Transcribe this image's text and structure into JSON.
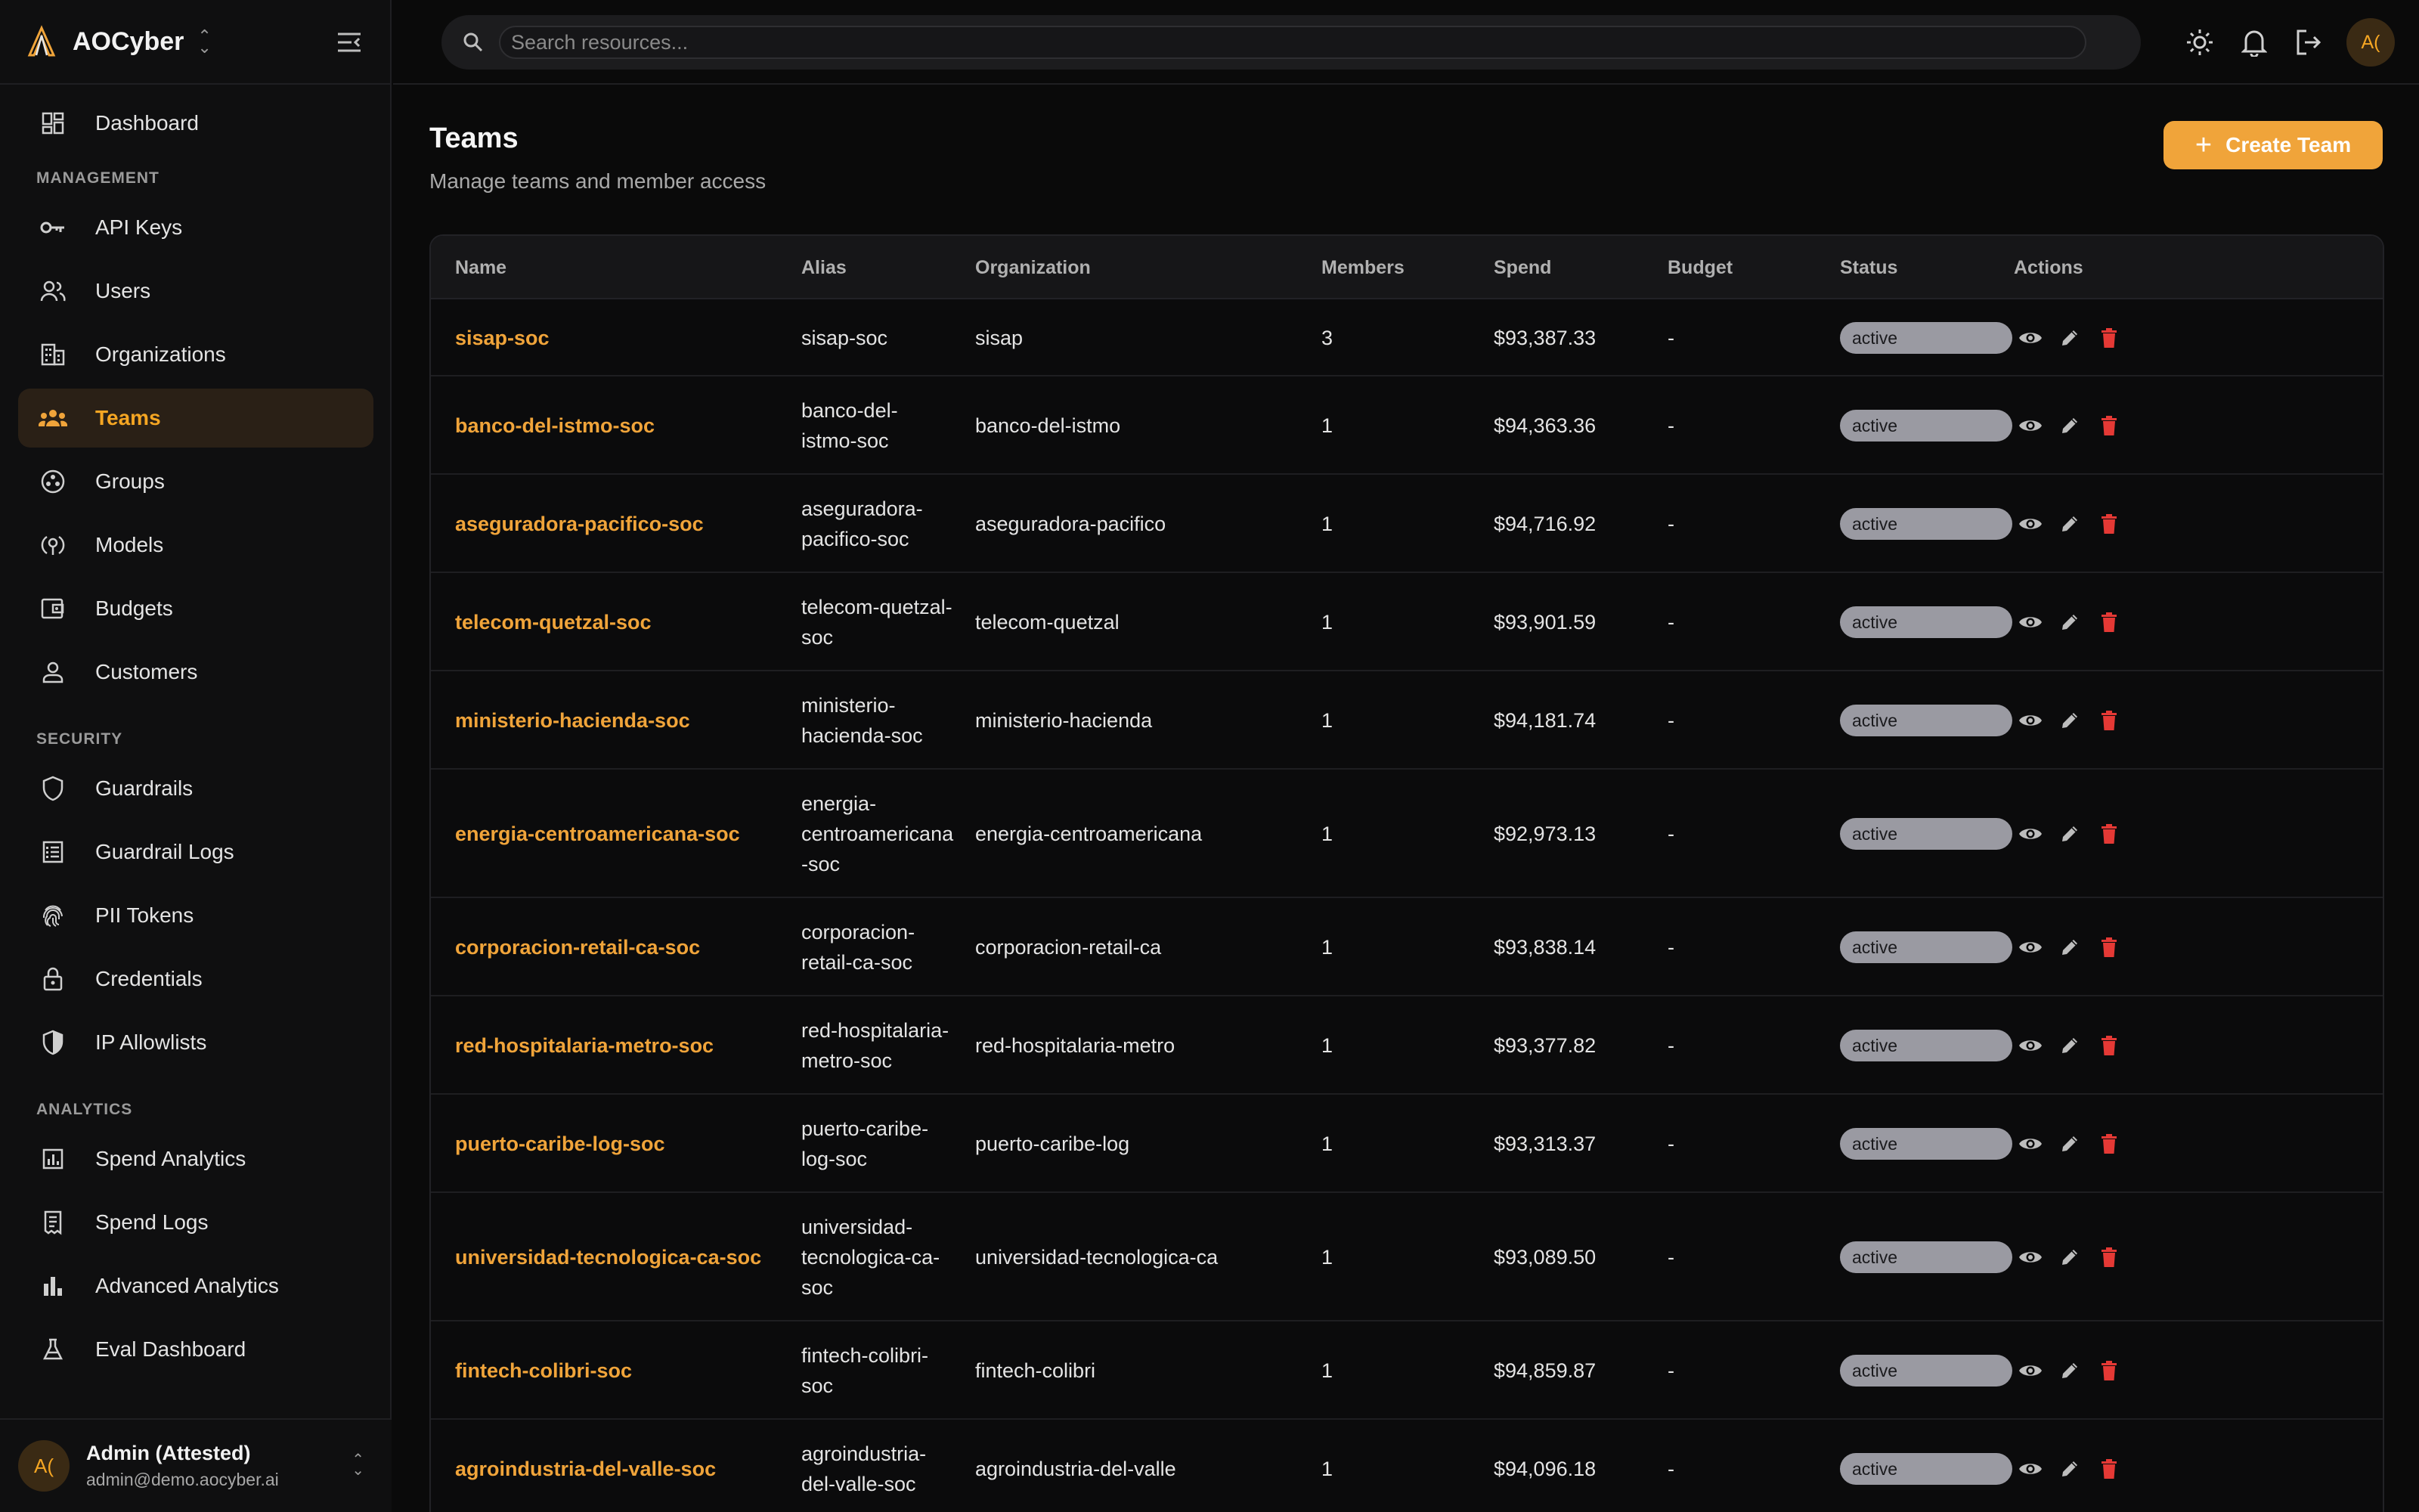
{
  "brand": {
    "name": "AOCyber"
  },
  "nav": {
    "top": [
      {
        "label": "Dashboard",
        "icon": "dashboard-icon"
      }
    ],
    "sections": [
      {
        "title": "MANAGEMENT",
        "items": [
          {
            "label": "API Keys",
            "icon": "key-icon"
          },
          {
            "label": "Users",
            "icon": "users-icon"
          },
          {
            "label": "Organizations",
            "icon": "building-icon"
          },
          {
            "label": "Teams",
            "icon": "team-icon",
            "active": true
          },
          {
            "label": "Groups",
            "icon": "groups-icon"
          },
          {
            "label": "Models",
            "icon": "models-icon"
          },
          {
            "label": "Budgets",
            "icon": "wallet-icon"
          },
          {
            "label": "Customers",
            "icon": "customer-icon"
          }
        ]
      },
      {
        "title": "SECURITY",
        "items": [
          {
            "label": "Guardrails",
            "icon": "shield-icon"
          },
          {
            "label": "Guardrail Logs",
            "icon": "logs-icon"
          },
          {
            "label": "PII Tokens",
            "icon": "fingerprint-icon"
          },
          {
            "label": "Credentials",
            "icon": "lock-icon"
          },
          {
            "label": "IP Allowlists",
            "icon": "shield-half-icon"
          }
        ]
      },
      {
        "title": "ANALYTICS",
        "items": [
          {
            "label": "Spend Analytics",
            "icon": "analytics-icon"
          },
          {
            "label": "Spend Logs",
            "icon": "receipt-icon"
          },
          {
            "label": "Advanced Analytics",
            "icon": "bar-chart-icon"
          },
          {
            "label": "Eval Dashboard",
            "icon": "flask-icon"
          }
        ]
      }
    ]
  },
  "user": {
    "initials": "A(",
    "name": "Admin (Attested)",
    "email": "admin@demo.aocyber.ai"
  },
  "search": {
    "placeholder": "Search resources..."
  },
  "page": {
    "title": "Teams",
    "subtitle": "Manage teams and member access",
    "create_label": "Create Team"
  },
  "colors": {
    "accent": "#f0a43a",
    "danger": "#e53935",
    "badge": "#9a9aa2"
  },
  "table": {
    "columns": [
      "Name",
      "Alias",
      "Organization",
      "Members",
      "Spend",
      "Budget",
      "Status",
      "Actions"
    ],
    "rows": [
      {
        "name": "sisap-soc",
        "alias": "sisap-soc",
        "org": "sisap",
        "members": "3",
        "spend": "$93,387.33",
        "budget": "-",
        "status": "active"
      },
      {
        "name": "banco-del-istmo-soc",
        "alias": "banco-del-\nistmo-soc",
        "org": "banco-del-istmo",
        "members": "1",
        "spend": "$94,363.36",
        "budget": "-",
        "status": "active"
      },
      {
        "name": "aseguradora-pacifico-soc",
        "alias": "aseguradora-\npacifico-soc",
        "org": "aseguradora-pacifico",
        "members": "1",
        "spend": "$94,716.92",
        "budget": "-",
        "status": "active"
      },
      {
        "name": "telecom-quetzal-soc",
        "alias": "telecom-quetzal-\nsoc",
        "org": "telecom-quetzal",
        "members": "1",
        "spend": "$93,901.59",
        "budget": "-",
        "status": "active"
      },
      {
        "name": "ministerio-hacienda-soc",
        "alias": "ministerio-\nhacienda-soc",
        "org": "ministerio-hacienda",
        "members": "1",
        "spend": "$94,181.74",
        "budget": "-",
        "status": "active"
      },
      {
        "name": "energia-centroamericana-soc",
        "alias": "energia-\ncentroamericana\n-soc",
        "org": "energia-centroamericana",
        "members": "1",
        "spend": "$92,973.13",
        "budget": "-",
        "status": "active"
      },
      {
        "name": "corporacion-retail-ca-soc",
        "alias": "corporacion-\nretail-ca-soc",
        "org": "corporacion-retail-ca",
        "members": "1",
        "spend": "$93,838.14",
        "budget": "-",
        "status": "active"
      },
      {
        "name": "red-hospitalaria-metro-soc",
        "alias": "red-hospitalaria-\nmetro-soc",
        "org": "red-hospitalaria-metro",
        "members": "1",
        "spend": "$93,377.82",
        "budget": "-",
        "status": "active"
      },
      {
        "name": "puerto-caribe-log-soc",
        "alias": "puerto-caribe-\nlog-soc",
        "org": "puerto-caribe-log",
        "members": "1",
        "spend": "$93,313.37",
        "budget": "-",
        "status": "active"
      },
      {
        "name": "universidad-tecnologica-ca-soc",
        "alias": "universidad-\ntecnologica-ca-\nsoc",
        "org": "universidad-tecnologica-ca",
        "members": "1",
        "spend": "$93,089.50",
        "budget": "-",
        "status": "active"
      },
      {
        "name": "fintech-colibri-soc",
        "alias": "fintech-colibri-\nsoc",
        "org": "fintech-colibri",
        "members": "1",
        "spend": "$94,859.87",
        "budget": "-",
        "status": "active"
      },
      {
        "name": "agroindustria-del-valle-soc",
        "alias": "agroindustria-\ndel-valle-soc",
        "org": "agroindustria-del-valle",
        "members": "1",
        "spend": "$94,096.18",
        "budget": "-",
        "status": "active"
      }
    ]
  }
}
